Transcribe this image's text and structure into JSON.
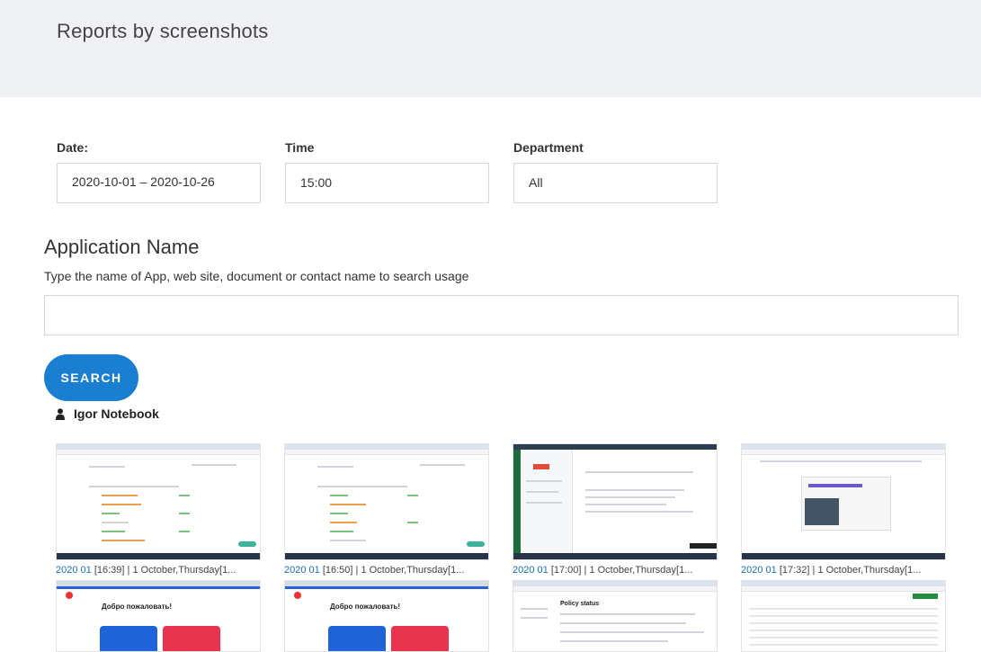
{
  "header": {
    "title": "Reports by screenshots"
  },
  "filters": {
    "date": {
      "label": "Date:",
      "value": "2020-10-01 – 2020-10-26"
    },
    "time": {
      "label": "Time",
      "value": "15:00"
    },
    "department": {
      "label": "Department",
      "value": "All"
    }
  },
  "app_search": {
    "title": "Application Name",
    "hint": "Type the name of App, web site, document or contact name to search usage",
    "value": "",
    "button_label": "SEARCH"
  },
  "user": {
    "name": "Igor Notebook",
    "icon": "user-icon"
  },
  "screenshots": [
    {
      "link": "2020 01",
      "time": "[16:39]",
      "rest": " | 1 October,Thursday[1..."
    },
    {
      "link": "2020 01",
      "time": "[16:50]",
      "rest": " | 1 October,Thursday[1..."
    },
    {
      "link": "2020 01",
      "time": "[17:00]",
      "rest": " | 1 October,Thursday[1..."
    },
    {
      "link": "2020 01",
      "time": "[17:32]",
      "rest": " | 1 October,Thursday[1..."
    }
  ],
  "thumb_texts": {
    "opera_welcome": "Добро пожаловать!",
    "policy_status": "Policy status"
  },
  "colors": {
    "accent": "#1a7fd1",
    "header_bg": "#eff1f5",
    "link": "#1a6fb8"
  }
}
